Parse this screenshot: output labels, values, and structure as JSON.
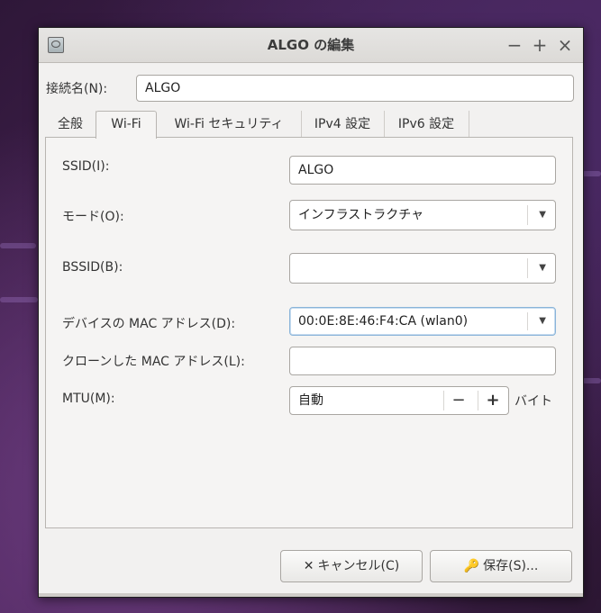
{
  "window": {
    "title": "ALGO の編集"
  },
  "window_controls": {
    "minimize": "−",
    "maximize": "+",
    "close": "×"
  },
  "connection_name": {
    "label": "接続名(N):",
    "value": "ALGO"
  },
  "tabs": [
    {
      "label": "全般"
    },
    {
      "label": "Wi-Fi",
      "active": true
    },
    {
      "label": "Wi-Fi セキュリティ"
    },
    {
      "label": "IPv4 設定"
    },
    {
      "label": "IPv6 設定"
    }
  ],
  "wifi": {
    "ssid": {
      "label": "SSID(I):",
      "value": "ALGO"
    },
    "mode": {
      "label": "モード(O):",
      "value": "インフラストラクチャ"
    },
    "bssid": {
      "label": "BSSID(B):",
      "value": ""
    },
    "device_mac": {
      "label": "デバイスの MAC アドレス(D):",
      "value": "00:0E:8E:46:F4:CA (wlan0)"
    },
    "cloned_mac": {
      "label": "クローンした MAC アドレス(L):",
      "value": ""
    },
    "mtu": {
      "label": "MTU(M):",
      "value": "自動",
      "unit": "バイト",
      "minus": "−",
      "plus": "+"
    }
  },
  "buttons": {
    "cancel": {
      "icon": "✕",
      "label": "キャンセル(C)"
    },
    "save": {
      "icon": "🔑",
      "label": "保存(S)..."
    }
  }
}
